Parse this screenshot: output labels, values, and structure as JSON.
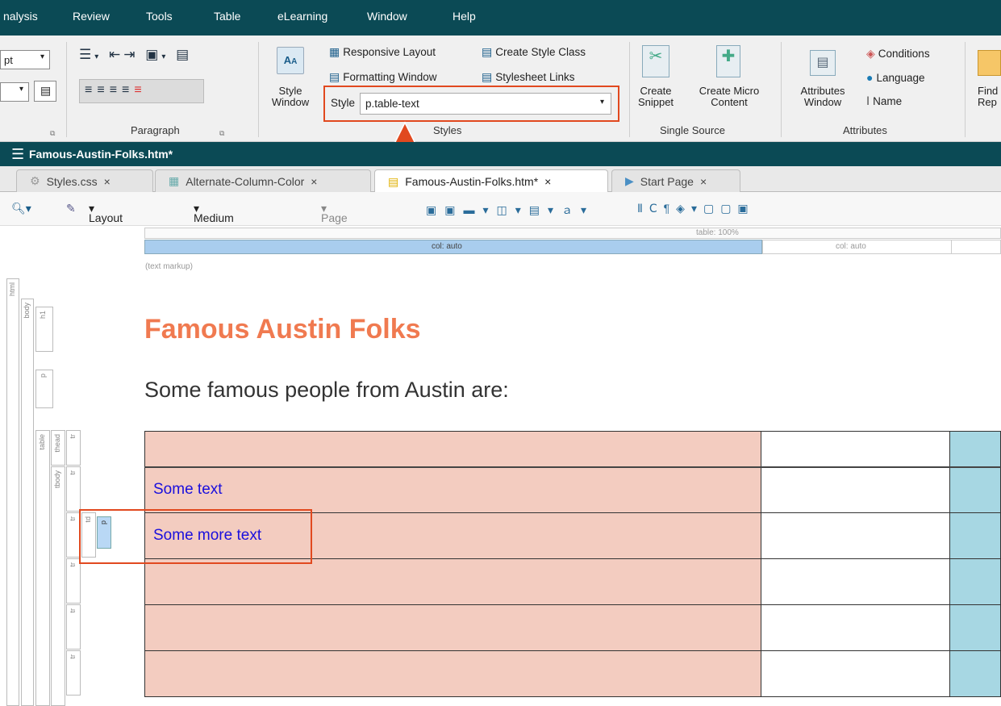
{
  "menubar": {
    "items": [
      "nalysis",
      "Review",
      "Tools",
      "Table",
      "eLearning",
      "Window",
      "Help"
    ]
  },
  "ribbon": {
    "font_combo_value": "pt",
    "group_paragraph": "Paragraph",
    "group_styles": "Styles",
    "group_single_source": "Single Source",
    "group_attributes": "Attributes",
    "style_window": "Style\nWindow",
    "responsive_layout": "Responsive Layout",
    "create_style_class": "Create Style Class",
    "formatting_window": "Formatting Window",
    "stylesheet_links": "Stylesheet Links",
    "style_label": "Style",
    "style_value": "p.table-text",
    "create_snippet": "Create\nSnippet",
    "create_micro_content": "Create Micro\nContent",
    "attributes_window": "Attributes\nWindow",
    "conditions": "Conditions",
    "language": "Language",
    "name": "Name",
    "find_replace": "Find\nRep"
  },
  "docbar": {
    "title": "Famous-Austin-Folks.htm*"
  },
  "tabs": [
    {
      "label": "Styles.css",
      "close": "×"
    },
    {
      "label": "Alternate-Column-Color",
      "close": "×"
    },
    {
      "label": "Famous-Austin-Folks.htm*",
      "close": "×"
    },
    {
      "label": "Start Page",
      "close": "×"
    }
  ],
  "toolbar": {
    "layout_web": "Layout (Web)",
    "medium": "Medium (default)",
    "page_layout": "Page Layout"
  },
  "ruler": {
    "table_label": "table: 100%",
    "col1": "col: auto",
    "col2": "col: auto",
    "markup": "(text markup)"
  },
  "structure": [
    "html",
    "body",
    "h1",
    "p",
    "table",
    "thead",
    "tr",
    "tbody",
    "tr",
    "tr",
    "td",
    "p",
    "tr",
    "tr",
    "tr"
  ],
  "document": {
    "heading": "Famous Austin Folks",
    "intro": "Some famous people from Austin are:",
    "rows": [
      "",
      "Some text",
      "Some more text",
      "",
      "",
      ""
    ]
  },
  "colors": {
    "accent": "#e1491f",
    "header": "#0b4a55",
    "col1": "#f3ccc0",
    "col3": "#a7d7e3"
  }
}
